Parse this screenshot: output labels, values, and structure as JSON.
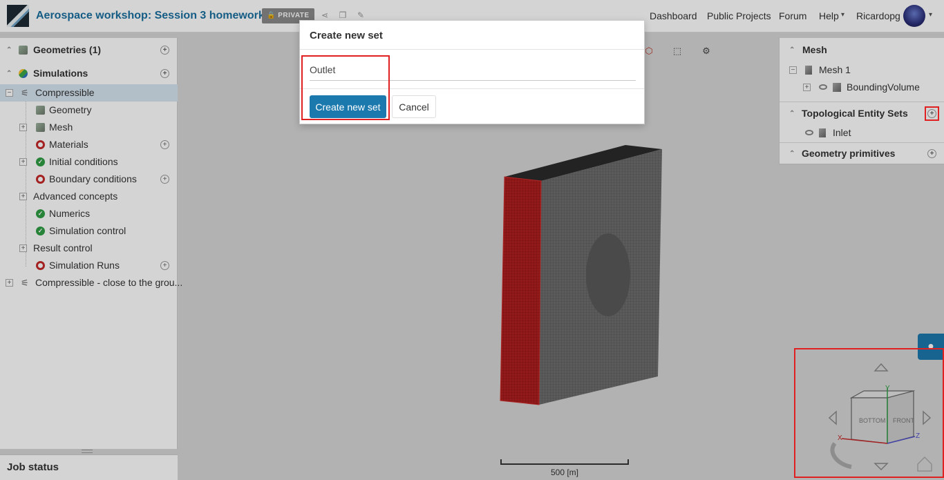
{
  "header": {
    "project_title": "Aerospace workshop: Session 3 homework",
    "privacy_badge": "🔒 PRIVATE",
    "nav": [
      "Dashboard",
      "Public Projects",
      "Forum",
      "Help",
      "Ricardopg"
    ]
  },
  "tree": {
    "items": [
      {
        "label": "Geometries (1)"
      },
      {
        "label": "Simulations"
      },
      {
        "label": "Compressible"
      },
      {
        "label": "Geometry"
      },
      {
        "label": "Mesh"
      },
      {
        "label": "Materials"
      },
      {
        "label": "Initial conditions"
      },
      {
        "label": "Boundary conditions"
      },
      {
        "label": "Advanced concepts"
      },
      {
        "label": "Numerics"
      },
      {
        "label": "Simulation control"
      },
      {
        "label": "Result control"
      },
      {
        "label": "Simulation Runs"
      },
      {
        "label": "Compressible - close to the grou..."
      }
    ]
  },
  "job_status": {
    "label": "Job status"
  },
  "right_panel": {
    "mesh_header": "Mesh",
    "mesh_item": "Mesh 1",
    "mesh_child": "BoundingVolume",
    "topo_header": "Topological Entity Sets",
    "topo_item": "Inlet",
    "geo_header": "Geometry primitives"
  },
  "modal": {
    "title": "Create new set",
    "input_value": "Outlet",
    "create_button": "Create new set",
    "cancel_button": "Cancel"
  },
  "viewport": {
    "scale_label": "500 [m]",
    "viewcube": {
      "face_left": "BOTTOM",
      "face_right": "FRONT",
      "axis_x": "X",
      "axis_y": "Y",
      "axis_z": "Z"
    }
  },
  "colors": {
    "accent": "#1c79ae",
    "highlight": "#e02020",
    "selected_face": "#b02020",
    "status_ok": "#2e9e44",
    "status_missing": "#c62828"
  }
}
